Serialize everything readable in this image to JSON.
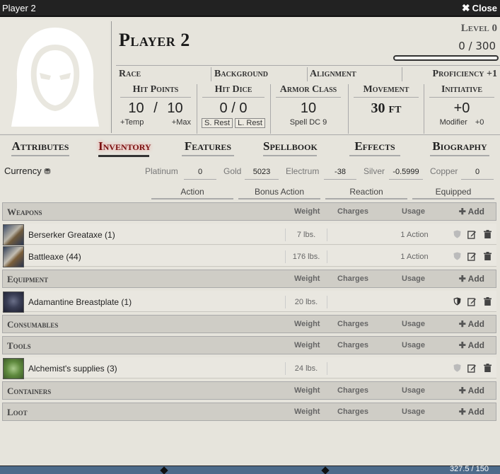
{
  "window": {
    "title": "Player 2",
    "close_label": "Close"
  },
  "character": {
    "name": "Player 2",
    "level": "Level 0",
    "xp": "0 / 300",
    "xp_fraction": 0
  },
  "traits": {
    "race": "Race",
    "background": "Background",
    "alignment": "Alignment",
    "proficiency": "Proficiency +1"
  },
  "stats": {
    "hp": {
      "label": "Hit Points",
      "value": "10",
      "sep": "/",
      "max": "10",
      "temp": "+Temp",
      "maxlbl": "+Max"
    },
    "hd": {
      "label": "Hit Dice",
      "value": "0 / 0",
      "short_rest": "S. Rest",
      "long_rest": "L. Rest"
    },
    "ac": {
      "label": "Armor Class",
      "value": "10",
      "sub": "Spell DC 9"
    },
    "mv": {
      "label": "Movement",
      "value": "30 ft"
    },
    "init": {
      "label": "Initiative",
      "value": "+0",
      "modlbl": "Modifier",
      "modval": "+0"
    }
  },
  "tabs": [
    "Attributes",
    "Inventory",
    "Features",
    "Spellbook",
    "Effects",
    "Biography"
  ],
  "active_tab": "Inventory",
  "currency": {
    "title": "Currency",
    "platinum": {
      "label": "Platinum",
      "value": "0"
    },
    "gold": {
      "label": "Gold",
      "value": "5023"
    },
    "electrum": {
      "label": "Electrum",
      "value": "-38"
    },
    "silver": {
      "label": "Silver",
      "value": "-0.5999"
    },
    "copper": {
      "label": "Copper",
      "value": "0"
    }
  },
  "actions": [
    "Action",
    "Bonus Action",
    "Reaction",
    "Equipped"
  ],
  "columns": {
    "weight": "Weight",
    "charges": "Charges",
    "usage": "Usage",
    "add": "Add"
  },
  "sections": {
    "weapons": {
      "name": "Weapons",
      "items": [
        {
          "name": "Berserker Greataxe (1)",
          "weight": "7 lbs.",
          "usage": "1 Action"
        },
        {
          "name": "Battleaxe (44)",
          "weight": "176 lbs.",
          "usage": "1 Action"
        }
      ]
    },
    "equipment": {
      "name": "Equipment",
      "items": [
        {
          "name": "Adamantine Breastplate (1)",
          "weight": "20 lbs.",
          "usage": ""
        }
      ]
    },
    "consumables": {
      "name": "Consumables",
      "items": []
    },
    "tools": {
      "name": "Tools",
      "items": [
        {
          "name": "Alchemist's supplies (3)",
          "weight": "24 lbs.",
          "usage": ""
        }
      ]
    },
    "containers": {
      "name": "Containers",
      "items": []
    },
    "loot": {
      "name": "Loot",
      "items": []
    }
  },
  "bottom": {
    "status": "327.5 / 150"
  },
  "colors": {
    "active_tab": "#7a1111",
    "bottom_bar": "#4d6b8a"
  },
  "icons": {
    "close": "close-icon",
    "coins": "coins-icon",
    "shield": "shield-icon",
    "edit": "edit-icon",
    "trash": "trash-icon",
    "plus": "plus-icon"
  }
}
